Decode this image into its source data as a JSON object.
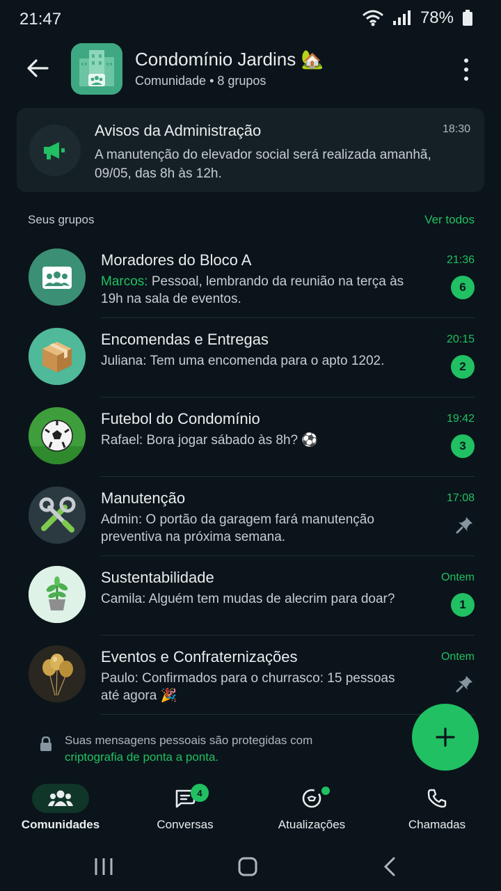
{
  "status_bar": {
    "time": "21:47",
    "battery": "78%"
  },
  "header": {
    "title": "Condomínio Jardins 🏡",
    "subtitle": "Comunidade • 8 grupos"
  },
  "announcement": {
    "title": "Avisos da Administração",
    "time": "18:30",
    "text": "A manutenção do elevador social será realizada amanhã, 09/05, das 8h às 12h."
  },
  "section": {
    "label": "Seus grupos",
    "link": "Ver todos"
  },
  "groups": [
    {
      "name": "Moradores do Bloco A",
      "sender": "Marcos:",
      "message": "Pessoal, lembrando da reunião na terça às 19h na sala de eventos.",
      "time": "21:36",
      "badge": "6",
      "avatar_icon": "group-icon"
    },
    {
      "name": "Encomendas e Entregas",
      "sender": "Juliana:",
      "message": "Tem uma encomenda para o apto 1202.",
      "time": "20:15",
      "badge": "2",
      "avatar_icon": "package-icon"
    },
    {
      "name": "Futebol do Condomínio",
      "sender": "Rafael:",
      "message": "Bora jogar sábado às 8h? ⚽",
      "time": "19:42",
      "badge": "3",
      "avatar_icon": "soccer-ball-icon"
    },
    {
      "name": "Manutenção",
      "sender": "Admin:",
      "message": "O portão da garagem fará manutenção preventiva na próxima semana.",
      "time": "17:08",
      "pinned": true,
      "avatar_icon": "tools-icon"
    },
    {
      "name": "Sustentabilidade",
      "sender": "Camila:",
      "message": "Alguém tem mudas de alecrim para doar?",
      "time": "Ontem",
      "badge": "1",
      "avatar_icon": "plant-icon"
    },
    {
      "name": "Eventos e Confraternizações",
      "sender": "Paulo:",
      "message": "Confirmados para o churrasco: 15 pessoas até agora 🎉",
      "time": "Ontem",
      "pinned": true,
      "avatar_icon": "balloons-icon"
    }
  ],
  "encryption": {
    "text": "Suas mensagens pessoais são protegidas com",
    "link": "criptografia de ponta a ponta."
  },
  "bottom_nav": [
    {
      "label": "Comunidades",
      "icon": "communities-icon",
      "active": true
    },
    {
      "label": "Conversas",
      "icon": "chats-icon",
      "badge": "4"
    },
    {
      "label": "Atualizações",
      "icon": "updates-icon",
      "dot": true
    },
    {
      "label": "Chamadas",
      "icon": "phone-icon"
    }
  ],
  "colors": {
    "accent": "#21c063",
    "background": "#0b141a",
    "card": "#152026"
  }
}
